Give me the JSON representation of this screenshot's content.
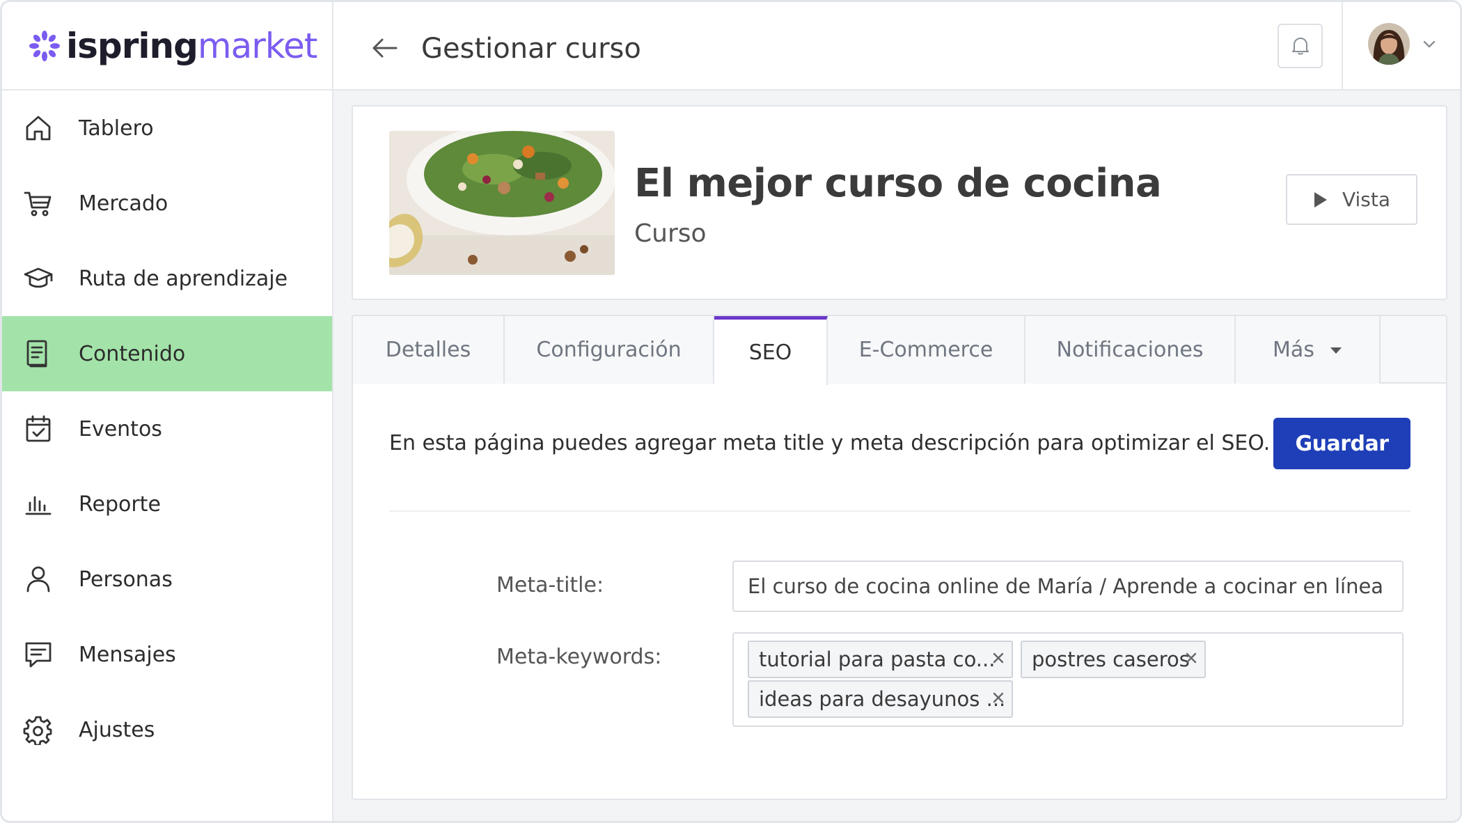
{
  "brand": {
    "word_dark": "ispring",
    "word_light": "market"
  },
  "colors": {
    "accent": "#7b5cf0",
    "active_nav": "#a3e3a9",
    "primary_button": "#1f3fb8",
    "active_tab_border": "#6a38c9"
  },
  "sidebar": {
    "items": [
      {
        "label": "Tablero",
        "icon": "home-icon",
        "active": false
      },
      {
        "label": "Mercado",
        "icon": "cart-icon",
        "active": false
      },
      {
        "label": "Ruta de aprendizaje",
        "icon": "graduation-cap-icon",
        "active": false
      },
      {
        "label": "Contenido",
        "icon": "content-icon",
        "active": true
      },
      {
        "label": "Eventos",
        "icon": "calendar-check-icon",
        "active": false
      },
      {
        "label": "Reporte",
        "icon": "bar-chart-icon",
        "active": false
      },
      {
        "label": "Personas",
        "icon": "person-icon",
        "active": false
      },
      {
        "label": "Mensajes",
        "icon": "message-icon",
        "active": false
      },
      {
        "label": "Ajustes",
        "icon": "gear-icon",
        "active": false
      }
    ]
  },
  "header": {
    "title": "Gestionar curso"
  },
  "course": {
    "title": "El mejor curso de cocina",
    "type": "Curso",
    "preview_label": "Vista"
  },
  "tabs": [
    {
      "label": "Detalles",
      "active": false
    },
    {
      "label": "Configuración",
      "active": false
    },
    {
      "label": "SEO",
      "active": true
    },
    {
      "label": "E-Commerce",
      "active": false
    },
    {
      "label": "Notificaciones",
      "active": false
    },
    {
      "label": "Más",
      "active": false
    }
  ],
  "seo": {
    "intro": "En esta página puedes agregar meta title y meta descripción para optimizar el SEO.",
    "save_label": "Guardar",
    "meta_title_label": "Meta-title:",
    "meta_title_value": "El curso de cocina online de María / Aprende a cocinar en línea",
    "meta_keywords_label": "Meta-keywords:",
    "keywords": [
      "tutorial para pasta co...",
      "postres caseros",
      "ideas para desayunos ..."
    ]
  }
}
